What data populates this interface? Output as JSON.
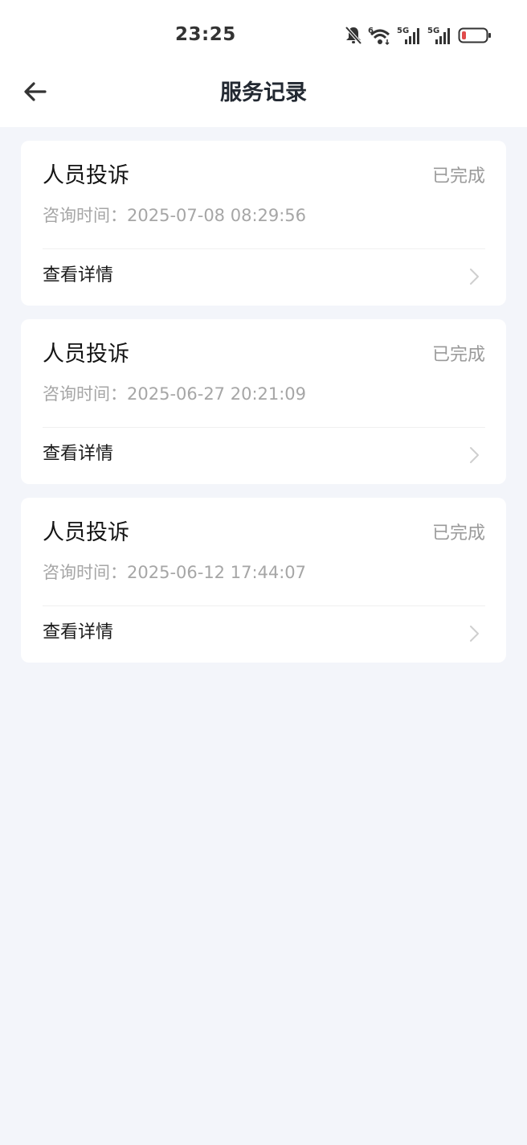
{
  "status_bar": {
    "time": "23:25",
    "icons": [
      "bell-off-icon",
      "wifi-6-icon",
      "signal-5g-icon",
      "signal-5g-icon",
      "battery-low-icon"
    ],
    "network_label_1": "5G",
    "network_label_2": "5G",
    "wifi_label": "6",
    "battery_color": "#e04b4b"
  },
  "header": {
    "title": "服务记录",
    "back_icon": "arrow-left-icon"
  },
  "records": [
    {
      "title": "人员投诉",
      "status": "已完成",
      "time": "咨询时间：2025-07-08 08:29:56",
      "detail_label": "查看详情"
    },
    {
      "title": "人员投诉",
      "status": "已完成",
      "time": "咨询时间：2025-06-27 20:21:09",
      "detail_label": "查看详情"
    },
    {
      "title": "人员投诉",
      "status": "已完成",
      "time": "咨询时间：2025-06-12 17:44:07",
      "detail_label": "查看详情"
    }
  ],
  "colors": {
    "page_background": "#f3f5fa",
    "card_background": "#ffffff",
    "muted_text": "#a6a6a6"
  }
}
